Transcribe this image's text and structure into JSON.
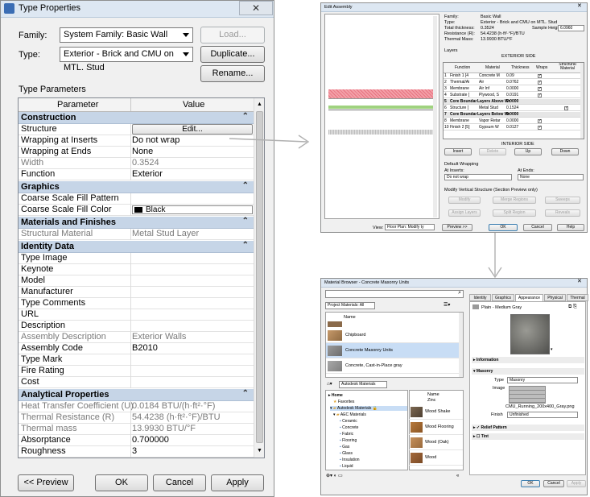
{
  "type_properties": {
    "title": "Type Properties",
    "close": "✕",
    "family_label": "Family:",
    "family_value": "System Family: Basic Wall",
    "type_label": "Type:",
    "type_value": "Exterior - Brick and CMU on MTL. Stud",
    "load_button": "Load...",
    "duplicate_button": "Duplicate...",
    "rename_button": "Rename...",
    "section_title": "Type Parameters",
    "col_parameter": "Parameter",
    "col_value": "Value",
    "groups": {
      "construction": "Construction",
      "graphics": "Graphics",
      "materials": "Materials and Finishes",
      "identity": "Identity Data",
      "analytical": "Analytical Properties"
    },
    "rows": {
      "structure": {
        "p": "Structure",
        "v": "Edit..."
      },
      "wrap_inserts": {
        "p": "Wrapping at Inserts",
        "v": "Do not wrap"
      },
      "wrap_ends": {
        "p": "Wrapping at Ends",
        "v": "None"
      },
      "width": {
        "p": "Width",
        "v": "0.3524"
      },
      "function": {
        "p": "Function",
        "v": "Exterior"
      },
      "fill_pattern": {
        "p": "Coarse Scale Fill Pattern",
        "v": ""
      },
      "fill_color": {
        "p": "Coarse Scale Fill Color",
        "v": "Black"
      },
      "struct_material": {
        "p": "Structural Material",
        "v": "Metal Stud Layer"
      },
      "type_image": {
        "p": "Type Image",
        "v": ""
      },
      "keynote": {
        "p": "Keynote",
        "v": ""
      },
      "model": {
        "p": "Model",
        "v": ""
      },
      "manufacturer": {
        "p": "Manufacturer",
        "v": ""
      },
      "type_comments": {
        "p": "Type Comments",
        "v": ""
      },
      "url": {
        "p": "URL",
        "v": ""
      },
      "description": {
        "p": "Description",
        "v": ""
      },
      "assembly_description": {
        "p": "Assembly Description",
        "v": "Exterior Walls"
      },
      "assembly_code": {
        "p": "Assembly Code",
        "v": "B2010"
      },
      "type_mark": {
        "p": "Type Mark",
        "v": ""
      },
      "fire_rating": {
        "p": "Fire Rating",
        "v": ""
      },
      "cost": {
        "p": "Cost",
        "v": ""
      },
      "heat_transfer": {
        "p": "Heat Transfer Coefficient (U)",
        "v": "0.0184 BTU/(h·ft²·°F)"
      },
      "thermal_resistance": {
        "p": "Thermal Resistance (R)",
        "v": "54.4238 (h·ft²·°F)/BTU"
      },
      "thermal_mass": {
        "p": "Thermal mass",
        "v": "13.9930 BTU/°F"
      },
      "absorptance": {
        "p": "Absorptance",
        "v": "0.700000"
      },
      "roughness": {
        "p": "Roughness",
        "v": "3"
      }
    },
    "preview_button": "<< Preview",
    "ok_button": "OK",
    "cancel_button": "Cancel",
    "apply_button": "Apply"
  },
  "edit_assembly": {
    "title": "Edit Assembly",
    "family_label": "Family:",
    "family_value": "Basic Wall",
    "type_label": "Type:",
    "type_value": "Exterior - Brick and CMU on MTL. Stud",
    "thickness_label": "Total thickness:",
    "thickness_value": "0.3524",
    "sample_label": "Sample Height:",
    "sample_value": "6.0960",
    "resistance_label": "Resistance (R):",
    "resistance_value": "54.4238 (h·ft²·°F)/BTU",
    "mass_label": "Thermal Mass:",
    "mass_value": "13.9930 BTU/°F",
    "layers_label": "Layers",
    "exterior_side": "EXTERIOR SIDE",
    "interior_side": "INTERIOR SIDE",
    "headers": {
      "function": "Function",
      "material": "Material",
      "thickness": "Thickness",
      "wraps": "Wraps",
      "structural": "Structural Material"
    },
    "layers": [
      {
        "n": "1",
        "f": "Finish 1 [4",
        "m": "Concrete M",
        "t": "0.09",
        "w": true,
        "s": false,
        "core": false
      },
      {
        "n": "2",
        "f": "Thermal/Ai",
        "m": "Air",
        "t": "0.0762",
        "w": true,
        "s": false,
        "core": false
      },
      {
        "n": "3",
        "f": "Membrane",
        "m": "Air Inf",
        "t": "0.0000",
        "w": true,
        "s": false,
        "core": false
      },
      {
        "n": "4",
        "f": "Substrate [",
        "m": "Plywood, S",
        "t": "0.0191",
        "w": true,
        "s": false,
        "core": false
      },
      {
        "n": "5",
        "f": "Core Boundar",
        "m": "Layers Above Wr",
        "t": "0.0000",
        "w": false,
        "s": false,
        "core": true
      },
      {
        "n": "6",
        "f": "Structure [",
        "m": "Metal Stud",
        "t": "0.1524",
        "w": false,
        "s": true,
        "core": false
      },
      {
        "n": "7",
        "f": "Core Boundar",
        "m": "Layers Below Wr",
        "t": "0.0000",
        "w": false,
        "s": false,
        "core": true
      },
      {
        "n": "8",
        "f": "Membrane",
        "m": "Vapor Retar",
        "t": "0.0000",
        "w": true,
        "s": false,
        "core": false
      },
      {
        "n": "10",
        "f": "Finish 2 [5]",
        "m": "Gypsum W",
        "t": "0.0127",
        "w": true,
        "s": false,
        "core": false
      }
    ],
    "insert_button": "Insert",
    "delete_button": "Delete",
    "up_button": "Up",
    "down_button": "Down",
    "default_wrapping": "Default Wrapping",
    "at_inserts_label": "At Inserts:",
    "at_inserts_value": "Do not wrap",
    "at_ends_label": "At Ends:",
    "at_ends_value": "None",
    "modify_label": "Modify Vertical Structure (Section Preview only)",
    "modify_button": "Modify",
    "merge_button": "Merge Regions",
    "sweeps_button": "Sweeps",
    "assign_button": "Assign Layers",
    "split_button": "Split Region",
    "reveals_button": "Reveals",
    "view_label": "View:",
    "view_value": "Floor Plan: Modify ty",
    "preview_button": "Preview >>",
    "ok_button": "OK",
    "cancel_button": "Cancel",
    "help_button": "Help"
  },
  "material_browser": {
    "title": "Material Browser - Concrete Masonry Units",
    "project_materials": "Project Materials: All",
    "name_header": "Name",
    "project_items": [
      "Chipboard",
      "Concrete Masonry Units",
      "Concrete, Cast-in-Place gray"
    ],
    "library_combo": "Autodesk Materials",
    "tree": {
      "home": "Home",
      "favorites": "Favorites",
      "autodesk_materials": "Autodesk Materials",
      "aec_materials": "AEC Materials",
      "ceramic": "Ceramic",
      "concrete": "Concrete",
      "fabric": "Fabric",
      "flooring": "Flooring",
      "gas": "Gas",
      "glass": "Glass",
      "insulation": "Insulation",
      "liquid": "Liquid"
    },
    "library_items": [
      "Zinc",
      "Wood Shake",
      "Wood Flooring",
      "Wood (Oak)",
      "Wood"
    ],
    "tabs": [
      "Identity",
      "Graphics",
      "Appearance",
      "Physical",
      "Thermal"
    ],
    "asset_name": "Plain - Medium Gray",
    "information": "Information",
    "masonry": "Masonry",
    "type_label": "Type",
    "type_value": "Masonry",
    "image_label": "Image",
    "image_file": "CMU_Running_200x400_Gray.png",
    "finish_label": "Finish",
    "finish_value": "Unfinished",
    "relief_pattern": "Relief Pattern",
    "tint": "Tint",
    "ok_button": "OK",
    "cancel_button": "Cancel",
    "apply_button": "Apply"
  },
  "colors": {
    "group_header": "#c6d5e7",
    "titlebar": "#dde7f2",
    "selection": "#c8ddf5"
  }
}
